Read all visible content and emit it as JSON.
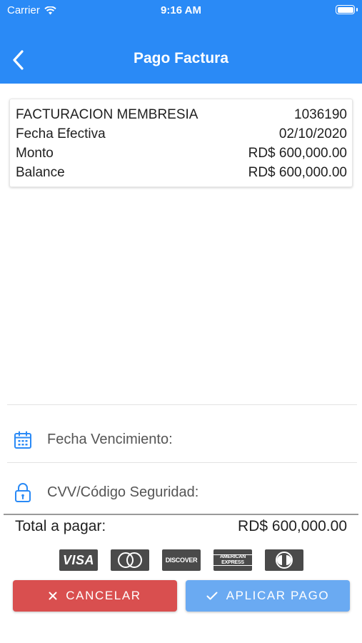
{
  "status_bar": {
    "carrier": "Carrier",
    "time": "9:16 AM"
  },
  "nav": {
    "title": "Pago Factura"
  },
  "invoice": {
    "rows": [
      {
        "label": "FACTURACION MEMBRESIA",
        "value": "1036190"
      },
      {
        "label": "Fecha Efectiva",
        "value": "02/10/2020"
      },
      {
        "label": "Monto",
        "value": "RD$ 600,000.00"
      },
      {
        "label": "Balance",
        "value": "RD$ 600,000.00"
      }
    ]
  },
  "form": {
    "expiry_label": "Fecha Vencimiento:",
    "cvv_label": "CVV/Código Seguridad:"
  },
  "total": {
    "label": "Total a pagar:",
    "value": "RD$ 600,000.00"
  },
  "card_brands": {
    "visa": "VISA",
    "discover": "DISCOVER",
    "amex_line1": "AMERICAN",
    "amex_line2": "EXPRESS"
  },
  "buttons": {
    "cancel": "CANCELAR",
    "apply": "APLICAR PAGO"
  },
  "colors": {
    "header": "#2a8af6",
    "cancel": "#d94f4f",
    "apply": "#6aaaf2",
    "icon": "#2a8af6"
  }
}
